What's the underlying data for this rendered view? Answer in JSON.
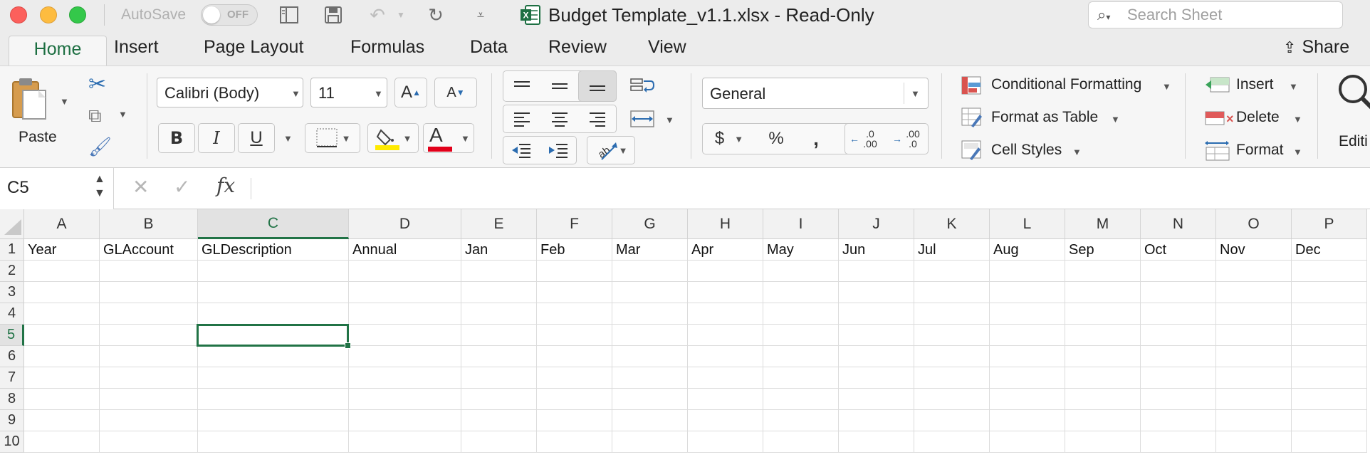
{
  "window": {
    "autosave_label": "AutoSave",
    "autosave_state": "OFF",
    "title": "Budget Template_v1.1.xlsx  -  Read-Only",
    "search_placeholder": "Search Sheet",
    "traffic_colors": [
      "#fc605c",
      "#fdbc40",
      "#34c84a"
    ]
  },
  "ribbon_tabs": [
    {
      "label": "Home",
      "active": true
    },
    {
      "label": "Insert"
    },
    {
      "label": "Page Layout"
    },
    {
      "label": "Formulas"
    },
    {
      "label": "Data"
    },
    {
      "label": "Review"
    },
    {
      "label": "View"
    }
  ],
  "share_label": "Share",
  "home_ribbon": {
    "paste_label": "Paste",
    "font_name": "Calibri (Body)",
    "font_size": "11",
    "bold": "B",
    "italic": "I",
    "underline": "U",
    "font_color_letter": "A",
    "grow_font": "A",
    "shrink_font": "A",
    "number_format": "General",
    "currency": "$",
    "percent": "%",
    "comma": ",",
    "increase_decimal": ".0 .00",
    "decrease_decimal": ".00 .0",
    "conditional_formatting": "Conditional Formatting",
    "format_as_table": "Format as Table",
    "cell_styles": "Cell Styles",
    "insert": "Insert",
    "delete": "Delete",
    "format": "Format",
    "editing": "Editi",
    "highlight_color": "#ffea00",
    "font_color": "#e2001a",
    "accent": "#217346"
  },
  "formula_bar": {
    "name_box": "C5",
    "fx": "fx",
    "content": ""
  },
  "sheet": {
    "columns": [
      "A",
      "B",
      "C",
      "D",
      "E",
      "F",
      "G",
      "H",
      "I",
      "J",
      "K",
      "L",
      "M",
      "N",
      "O",
      "P"
    ],
    "rows": [
      "1",
      "2",
      "3",
      "4",
      "5",
      "6",
      "7",
      "8",
      "9",
      "10"
    ],
    "selected_cell": "C5",
    "row1": [
      "Year",
      "GLAccount",
      "GLDescription",
      "Annual",
      "Jan",
      "Feb",
      "Mar",
      "Apr",
      "May",
      "Jun",
      "Jul",
      "Aug",
      "Sep",
      "Oct",
      "Nov",
      "Dec"
    ]
  }
}
